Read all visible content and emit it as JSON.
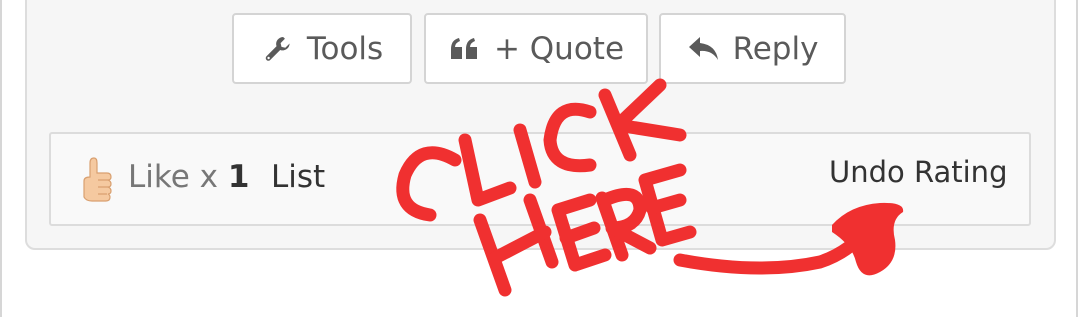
{
  "toolbar": {
    "tools_label": "Tools",
    "quote_label": "+ Quote",
    "reply_label": "Reply"
  },
  "reactions": {
    "like_prefix": "Like x ",
    "like_count": "1",
    "list_label": "List",
    "undo_label": "Undo Rating"
  },
  "annotation": {
    "line1": "CLICK",
    "line2": "HERE",
    "color": "#f03030"
  },
  "icons": {
    "tools": "wrench-icon",
    "quote": "quote-icon",
    "reply": "reply-arrow-icon",
    "like": "thumbs-up-icon"
  }
}
